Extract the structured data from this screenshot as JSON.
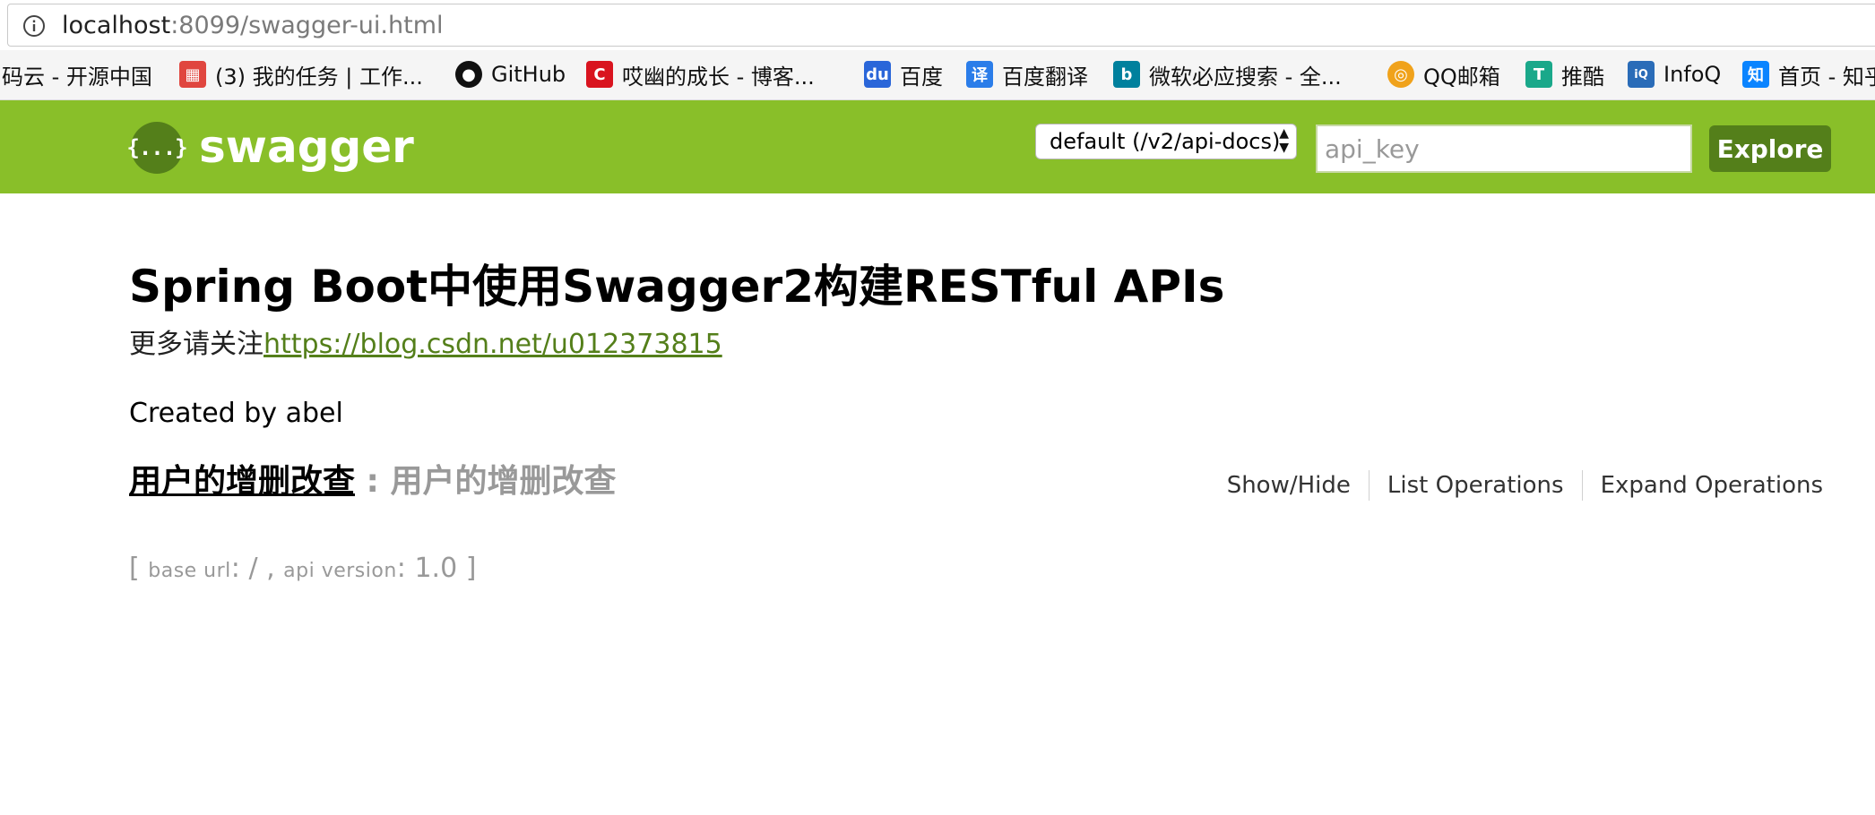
{
  "browser": {
    "url_host": "localhost",
    "url_rest": ":8099/swagger-ui.html"
  },
  "bookmarks": [
    {
      "label": "码云 - 开源中国",
      "icon": "none",
      "color": ""
    },
    {
      "label": "(3) 我的任务 | 工作...",
      "icon": "task-icon",
      "color": "#e0463f"
    },
    {
      "label": "GitHub",
      "icon": "github-icon",
      "color": "#111111"
    },
    {
      "label": "哎幽的成长 - 博客...",
      "icon": "csdn-icon",
      "color": "#d9141f"
    },
    {
      "label": "百度",
      "icon": "baidu-icon",
      "color": "#2a66d9"
    },
    {
      "label": "百度翻译",
      "icon": "translate-icon",
      "color": "#2b7de9"
    },
    {
      "label": "微软必应搜索 - 全...",
      "icon": "bing-icon",
      "color": "#00809d"
    },
    {
      "label": "QQ邮箱",
      "icon": "qqmail-icon",
      "color": "#f0a21b"
    },
    {
      "label": "推酷",
      "icon": "tuicool-icon",
      "color": "#1aa88a"
    },
    {
      "label": "InfoQ",
      "icon": "infoq-icon",
      "color": "#2a6cb8"
    },
    {
      "label": "首页 - 知乎",
      "icon": "zhihu-icon",
      "color": "#0a84ff"
    }
  ],
  "header": {
    "logo_glyph": "{...}",
    "logo_text": "swagger",
    "spec_select": "default (/v2/api-docs)",
    "api_key_placeholder": "api_key",
    "explore_label": "Explore",
    "brand_color": "#89bf29",
    "dark_color": "#547f1a"
  },
  "info": {
    "title": "Spring Boot中使用Swagger2构建RESTful APIs",
    "desc_prefix": "更多请关注",
    "desc_link": "https://blog.csdn.net/u012373815",
    "created_by": "Created by abel"
  },
  "resource": {
    "name": "用户的增删改查",
    "separator": " : ",
    "description": "用户的增删改查",
    "ops": [
      "Show/Hide",
      "List Operations",
      "Expand Operations"
    ]
  },
  "footer": {
    "open": "[ ",
    "base_url_label": "base url",
    "base_url_value": ": / , ",
    "api_version_label": "api version",
    "api_version_value": ": 1.0 ",
    "close": "]"
  }
}
